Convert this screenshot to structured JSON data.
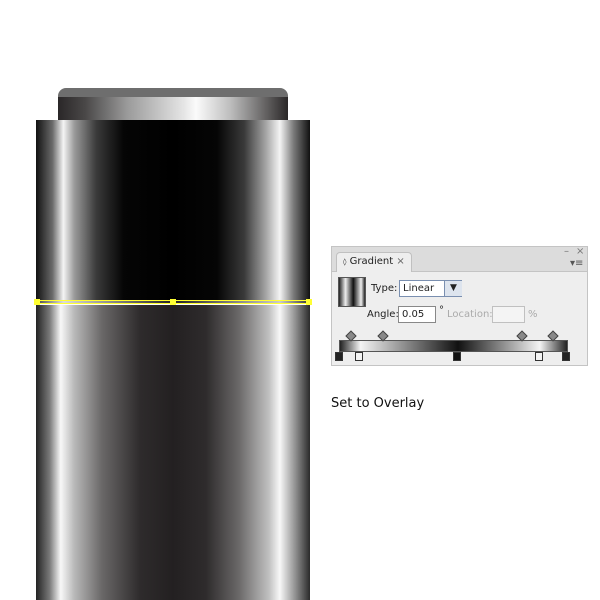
{
  "canvas": {
    "selection_color": "#ffff33"
  },
  "panel": {
    "tab_label": "Gradient",
    "tab_icon": "collapse-arrows-icon",
    "close_tab": "×",
    "minimize": "–",
    "close": "×",
    "menu_icon": "panel-menu-icon",
    "type_label": "Type:",
    "type_value": "Linear",
    "angle_label": "Angle:",
    "angle_value": "0.05",
    "degree": "°",
    "location_label": "Location:",
    "location_value": "",
    "percent": "%",
    "stops": [
      {
        "color": "#222222",
        "position": 0
      },
      {
        "color": "#f4f4f4",
        "position": 9
      },
      {
        "color": "#111111",
        "position": 52
      },
      {
        "color": "#f4f4f4",
        "position": 88
      },
      {
        "color": "#222222",
        "position": 100
      }
    ],
    "midpoints": [
      5,
      19,
      80,
      94
    ]
  },
  "caption": "Set to Overlay"
}
